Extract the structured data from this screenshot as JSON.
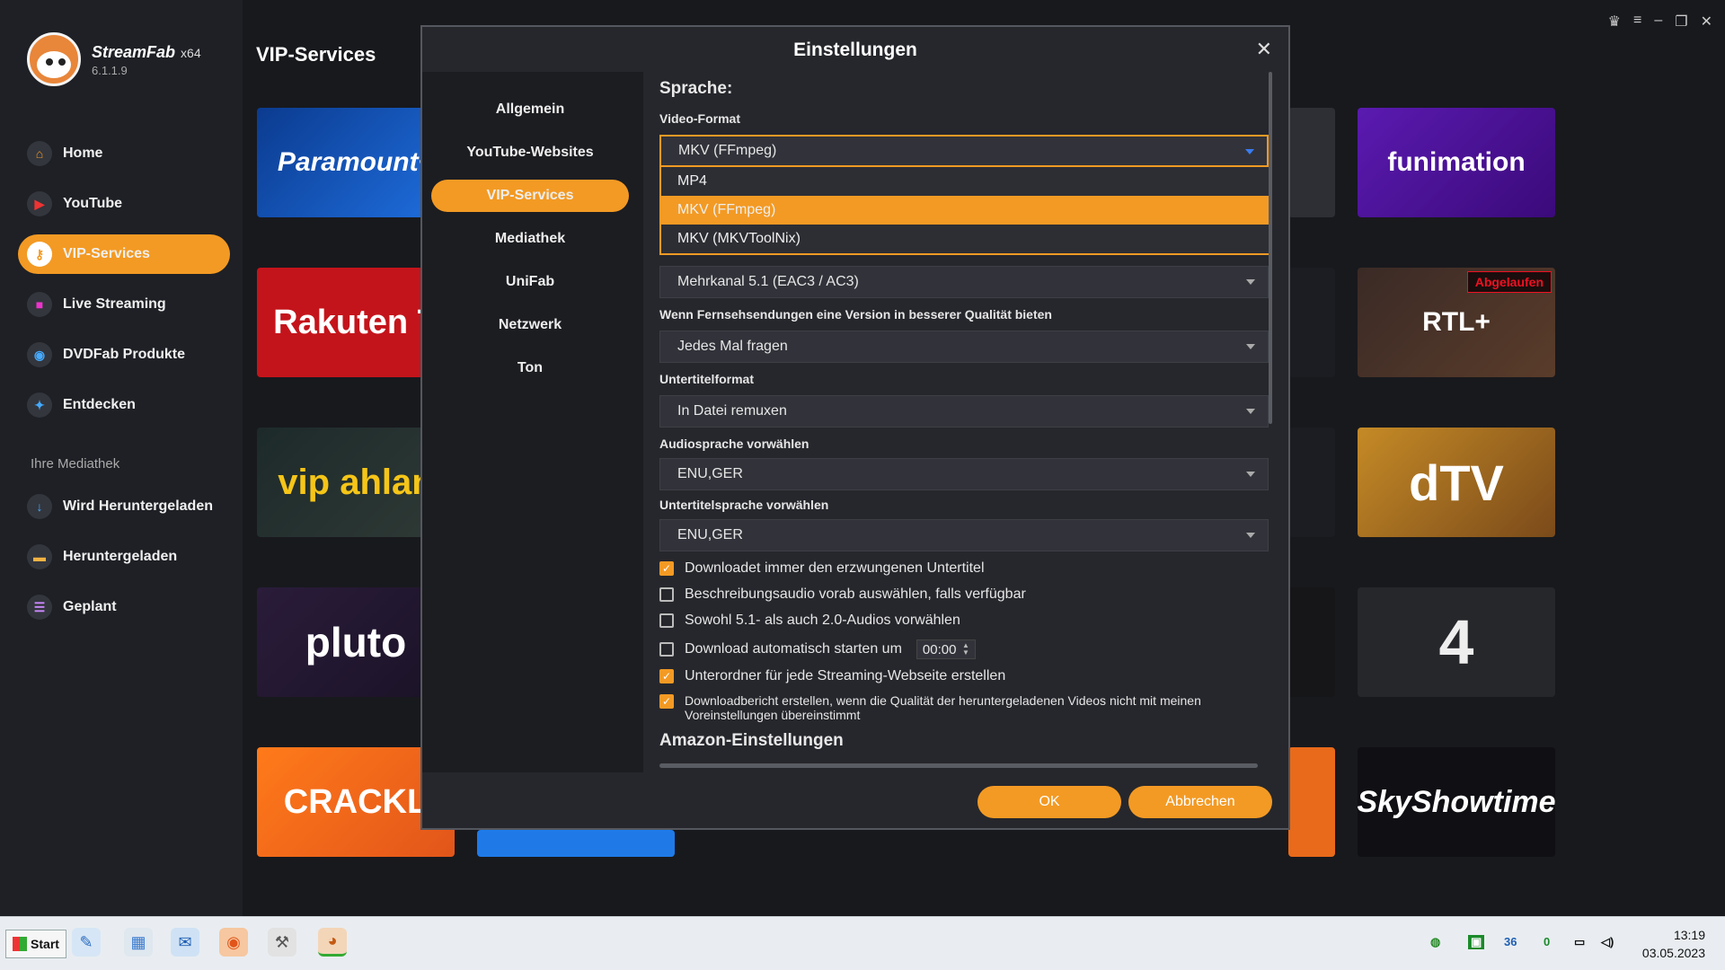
{
  "app": {
    "name": "StreamFab",
    "arch": "x64",
    "version": "6.1.1.9"
  },
  "sidebar": {
    "items": [
      {
        "label": "Home",
        "icon": "home-icon"
      },
      {
        "label": "YouTube",
        "icon": "youtube-icon"
      },
      {
        "label": "VIP-Services",
        "icon": "key-icon",
        "active": true
      },
      {
        "label": "Live Streaming",
        "icon": "camera-icon"
      },
      {
        "label": "DVDFab Produkte",
        "icon": "dvdfab-icon"
      },
      {
        "label": "Entdecken",
        "icon": "compass-icon"
      }
    ],
    "library_label": "Ihre Mediathek",
    "library": [
      {
        "label": "Wird Heruntergeladen",
        "icon": "download-icon"
      },
      {
        "label": "Heruntergeladen",
        "icon": "folder-icon"
      },
      {
        "label": "Geplant",
        "icon": "schedule-icon"
      }
    ]
  },
  "content": {
    "title": "VIP-Services",
    "tiles": [
      {
        "label": "Paramount+"
      },
      {
        "label": "funimation"
      },
      {
        "label": "Rakuten T"
      },
      {
        "label": "RTL+",
        "badge": "Abgelaufen"
      },
      {
        "label": "vip ahlan"
      },
      {
        "label": "dTV"
      },
      {
        "label": "pluto"
      },
      {
        "label": "4"
      },
      {
        "label": "CRACKL"
      },
      {
        "label": "SkyShowtime"
      }
    ]
  },
  "dialog": {
    "title": "Einstellungen",
    "nav": [
      "Allgemein",
      "YouTube-Websites",
      "VIP-Services",
      "Mediathek",
      "UniFab",
      "Netzwerk",
      "Ton"
    ],
    "active_nav": "VIP-Services",
    "section_language": "Sprache:",
    "video_format_label": "Video-Format",
    "video_format_value": "MKV (FFmpeg)",
    "video_format_options": [
      "MP4",
      "MKV (FFmpeg)",
      "MKV (MKVToolNix)"
    ],
    "audio_value": "Mehrkanal 5.1 (EAC3 / AC3)",
    "better_quality_label": "Wenn Fernsehsendungen eine Version in besserer Qualität bieten",
    "better_quality_value": "Jedes Mal fragen",
    "subtitle_format_label": "Untertitelformat",
    "subtitle_format_value": "In Datei remuxen",
    "audio_lang_label": "Audiosprache vorwählen",
    "audio_lang_value": "ENU,GER",
    "subtitle_lang_label": "Untertitelsprache vorwählen",
    "subtitle_lang_value": "ENU,GER",
    "checkboxes": [
      {
        "label": "Downloadet immer den erzwungenen Untertitel",
        "checked": true
      },
      {
        "label": "Beschreibungsaudio vorab auswählen, falls verfügbar",
        "checked": false
      },
      {
        "label": "Sowohl 5.1- als auch 2.0-Audios vorwählen",
        "checked": false
      },
      {
        "label": "Download automatisch starten um",
        "checked": false,
        "time": "00:00"
      },
      {
        "label": "Unterordner für jede Streaming-Webseite erstellen",
        "checked": true
      },
      {
        "label": "Downloadbericht erstellen, wenn die Qualität der heruntergeladenen Videos nicht mit meinen Voreinstellungen übereinstimmt",
        "checked": true
      }
    ],
    "section_amazon": "Amazon-Einstellungen",
    "ok_label": "OK",
    "cancel_label": "Abbrechen"
  },
  "taskbar": {
    "start_label": "Start",
    "tray": [
      "36",
      "0"
    ],
    "time": "13:19",
    "date": "03.05.2023"
  },
  "colors": {
    "accent": "#f39a24",
    "expired": "#e11122"
  }
}
